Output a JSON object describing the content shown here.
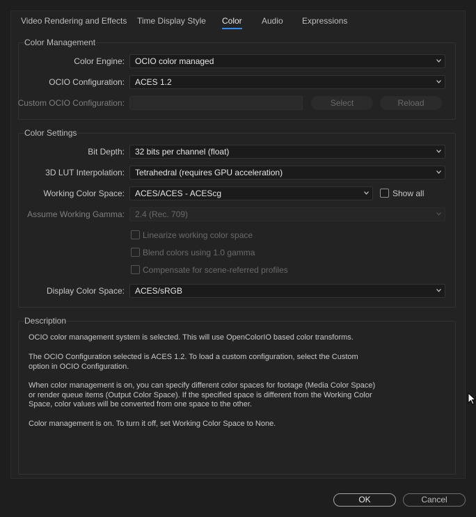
{
  "tabs": [
    {
      "label": "Video Rendering and Effects"
    },
    {
      "label": "Time Display Style"
    },
    {
      "label": "Color"
    },
    {
      "label": "Audio"
    },
    {
      "label": "Expressions"
    }
  ],
  "color_management": {
    "title": "Color Management",
    "color_engine": {
      "label": "Color Engine:",
      "value": "OCIO color managed"
    },
    "ocio_config": {
      "label": "OCIO Configuration:",
      "value": "ACES 1.2"
    },
    "custom_ocio": {
      "label": "Custom OCIO Configuration:",
      "value": "",
      "select_label": "Select",
      "reload_label": "Reload"
    }
  },
  "color_settings": {
    "title": "Color Settings",
    "bit_depth": {
      "label": "Bit Depth:",
      "value": "32 bits per channel (float)"
    },
    "lut_interp": {
      "label": "3D LUT Interpolation:",
      "value": "Tetrahedral (requires GPU acceleration)"
    },
    "working_space": {
      "label": "Working Color Space:",
      "value": "ACES/ACES - ACEScg",
      "show_all_label": "Show all"
    },
    "assume_gamma": {
      "label": "Assume Working Gamma:",
      "value": "2.4 (Rec. 709)"
    },
    "linearize_label": "Linearize working color space",
    "blend_label": "Blend colors using 1.0 gamma",
    "compensate_label": "Compensate for scene-referred profiles",
    "display_space": {
      "label": "Display Color Space:",
      "value": "ACES/sRGB"
    }
  },
  "description": {
    "title": "Description",
    "p1": "OCIO color management system is selected. This will use OpenColorIO based color transforms.",
    "p2": "The OCIO Configuration selected is ACES 1.2. To load a custom configuration, select the Custom option in OCIO Configuration.",
    "p3": "When color management is on, you can specify different color spaces for footage (Media Color Space) or render queue items (Output Color Space). If the specified space is different from the Working Color Space, color values will be converted from one space to the other.",
    "p4": "Color management is on. To turn it off, set Working Color Space to None."
  },
  "buttons": {
    "ok": "OK",
    "cancel": "Cancel"
  },
  "colors": {
    "accent": "#2d8ceb",
    "background": "#1e1e1e",
    "panel": "#232323"
  }
}
